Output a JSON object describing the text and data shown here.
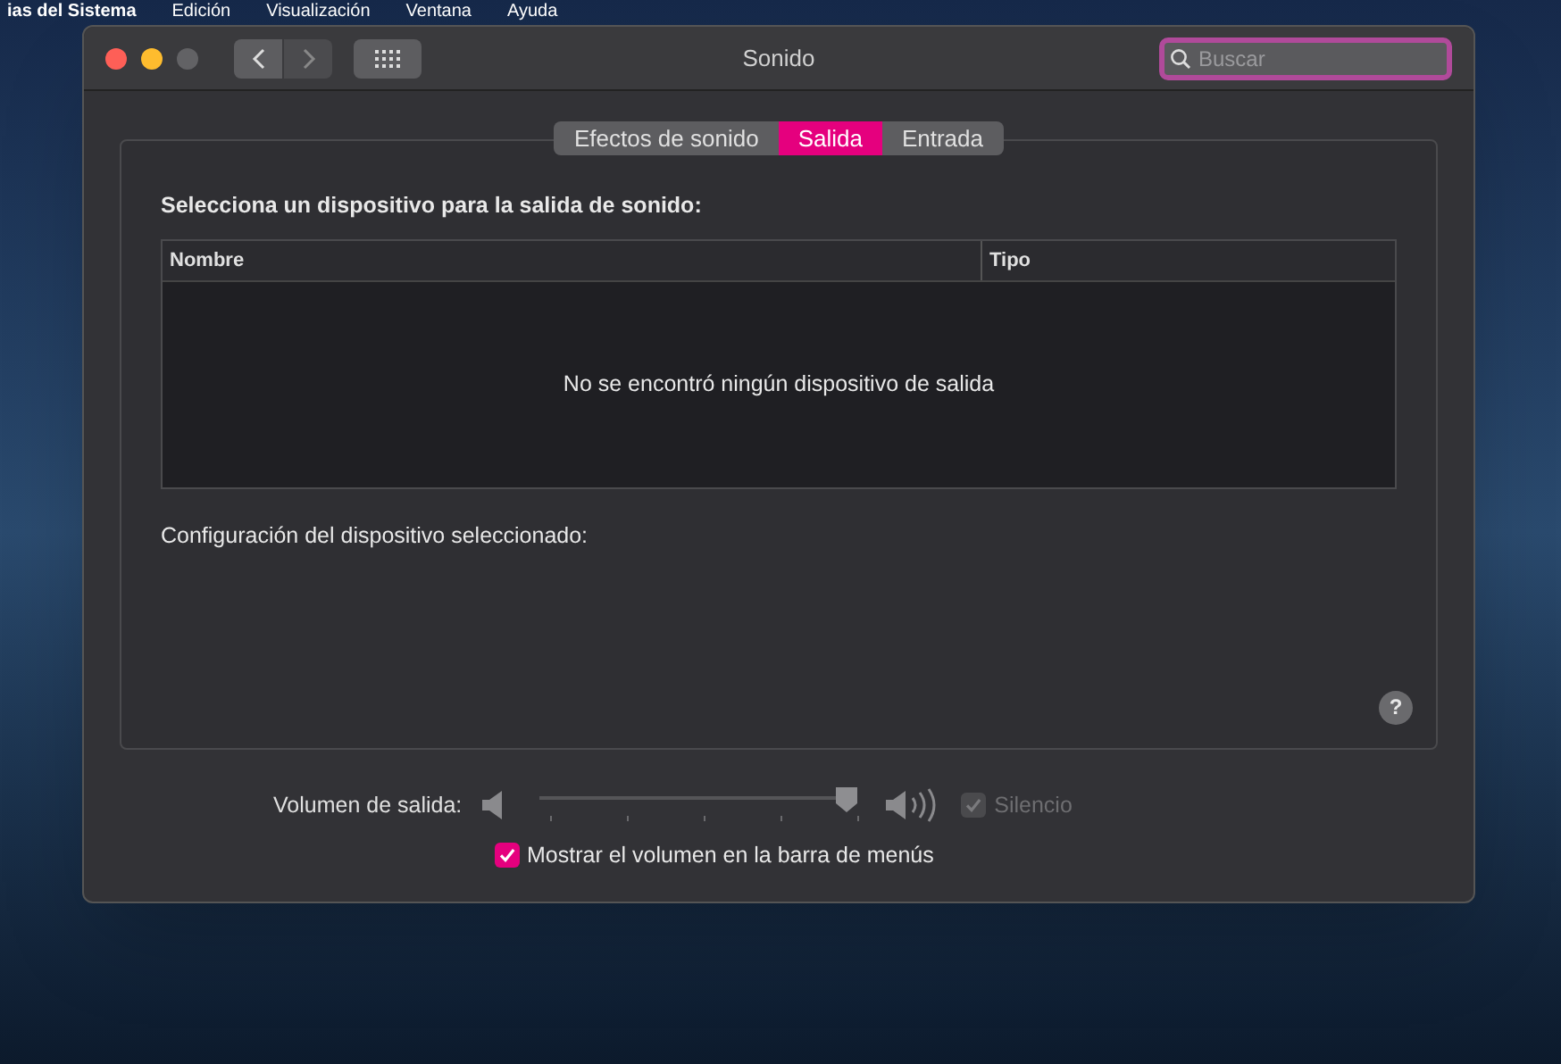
{
  "menu_bar": {
    "items": [
      "ias del Sistema",
      "Edición",
      "Visualización",
      "Ventana",
      "Ayuda"
    ]
  },
  "window": {
    "title": "Sonido"
  },
  "search": {
    "placeholder": "Buscar"
  },
  "tabs": [
    {
      "label": "Efectos de sonido",
      "selected": false
    },
    {
      "label": "Salida",
      "selected": true
    },
    {
      "label": "Entrada",
      "selected": false
    }
  ],
  "device_heading": "Selecciona un dispositivo para la salida de sonido:",
  "table": {
    "columns": [
      "Nombre",
      "Tipo"
    ],
    "empty_message": "No se encontró ningún dispositivo de salida"
  },
  "settings_heading": "Configuración del dispositivo seleccionado:",
  "help_button": "?",
  "volume": {
    "label": "Volumen de salida:",
    "level": 0.97
  },
  "mute": {
    "label": "Silencio",
    "checked": true,
    "disabled": true
  },
  "show_in_menu_bar": {
    "label": "Mostrar el volumen en la barra de menús",
    "checked": true
  }
}
